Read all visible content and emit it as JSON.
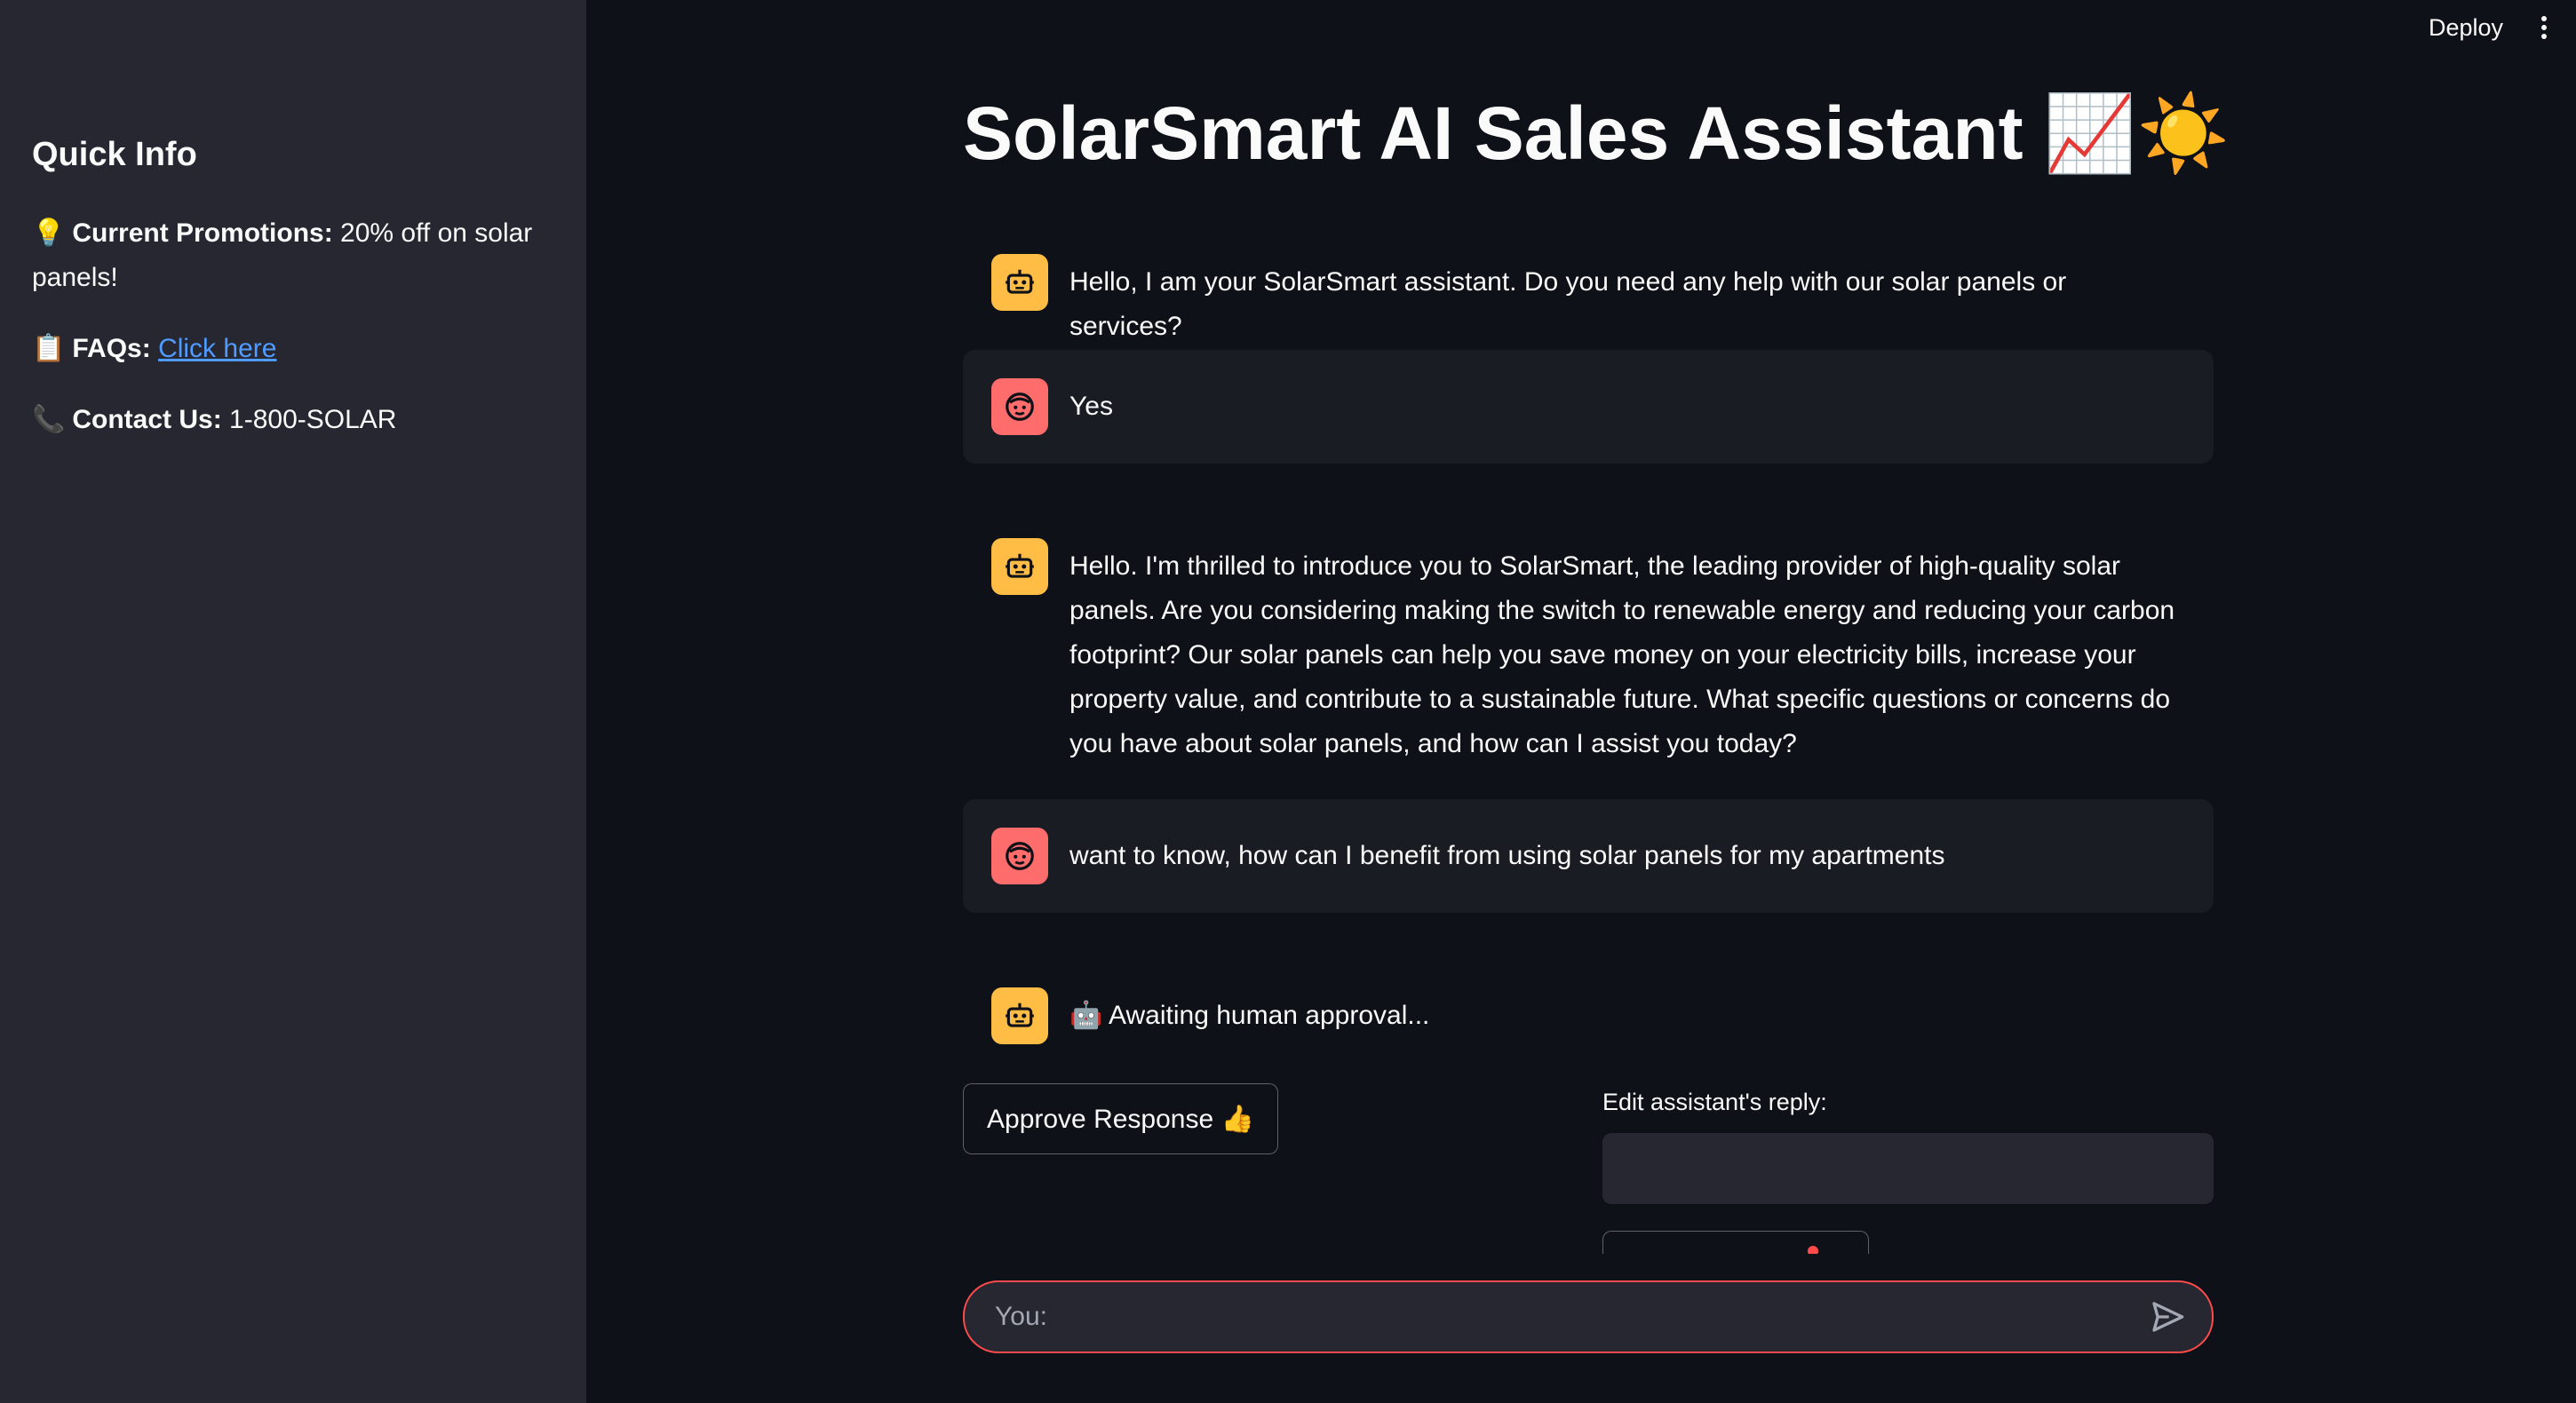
{
  "header": {
    "deploy_label": "Deploy",
    "menu_icon": "kebab-menu-icon"
  },
  "sidebar": {
    "heading": "Quick Info",
    "promotions": {
      "emoji": "💡",
      "label": "Current Promotions:",
      "value": "20% off on solar panels!"
    },
    "faqs": {
      "emoji": "📋",
      "label": "FAQs:",
      "link_text": "Click here"
    },
    "contact": {
      "emoji": "📞",
      "label": "Contact Us:",
      "value": "1-800-SOLAR"
    }
  },
  "main": {
    "title": "SolarSmart AI Sales Assistant 📈☀️"
  },
  "messages": [
    {
      "role": "assistant",
      "avatar_icon": "robot-icon",
      "text": "Hello, I am your SolarSmart assistant. Do you need any help with our solar panels or services?"
    },
    {
      "role": "user",
      "avatar_icon": "face-icon",
      "text": "Yes"
    },
    {
      "role": "assistant",
      "avatar_icon": "robot-icon",
      "text": "Hello. I'm thrilled to introduce you to SolarSmart, the leading provider of high-quality solar panels. Are you considering making the switch to renewable energy and reducing your carbon footprint? Our solar panels can help you save money on your electricity bills, increase your property value, and contribute to a sustainable future. What specific questions or concerns do you have about solar panels, and how can I assist you today?"
    },
    {
      "role": "user",
      "avatar_icon": "face-icon",
      "text": "want to know, how can I benefit from using solar panels for my apartments"
    },
    {
      "role": "assistant",
      "avatar_icon": "robot-icon",
      "text": "🤖 Awaiting human approval..."
    }
  ],
  "approval": {
    "approve_label": "Approve Response 👍",
    "edit_label": "Edit assistant's reply:",
    "edit_value": ""
  },
  "chat_input": {
    "placeholder": "You:",
    "send_icon": "send-icon"
  },
  "colors": {
    "background": "#0e1117",
    "sidebar": "#262730",
    "bot_avatar": "#ffbd45",
    "user_avatar": "#ff6c6c",
    "accent": "#ff4b4b",
    "link": "#4f9bff"
  }
}
